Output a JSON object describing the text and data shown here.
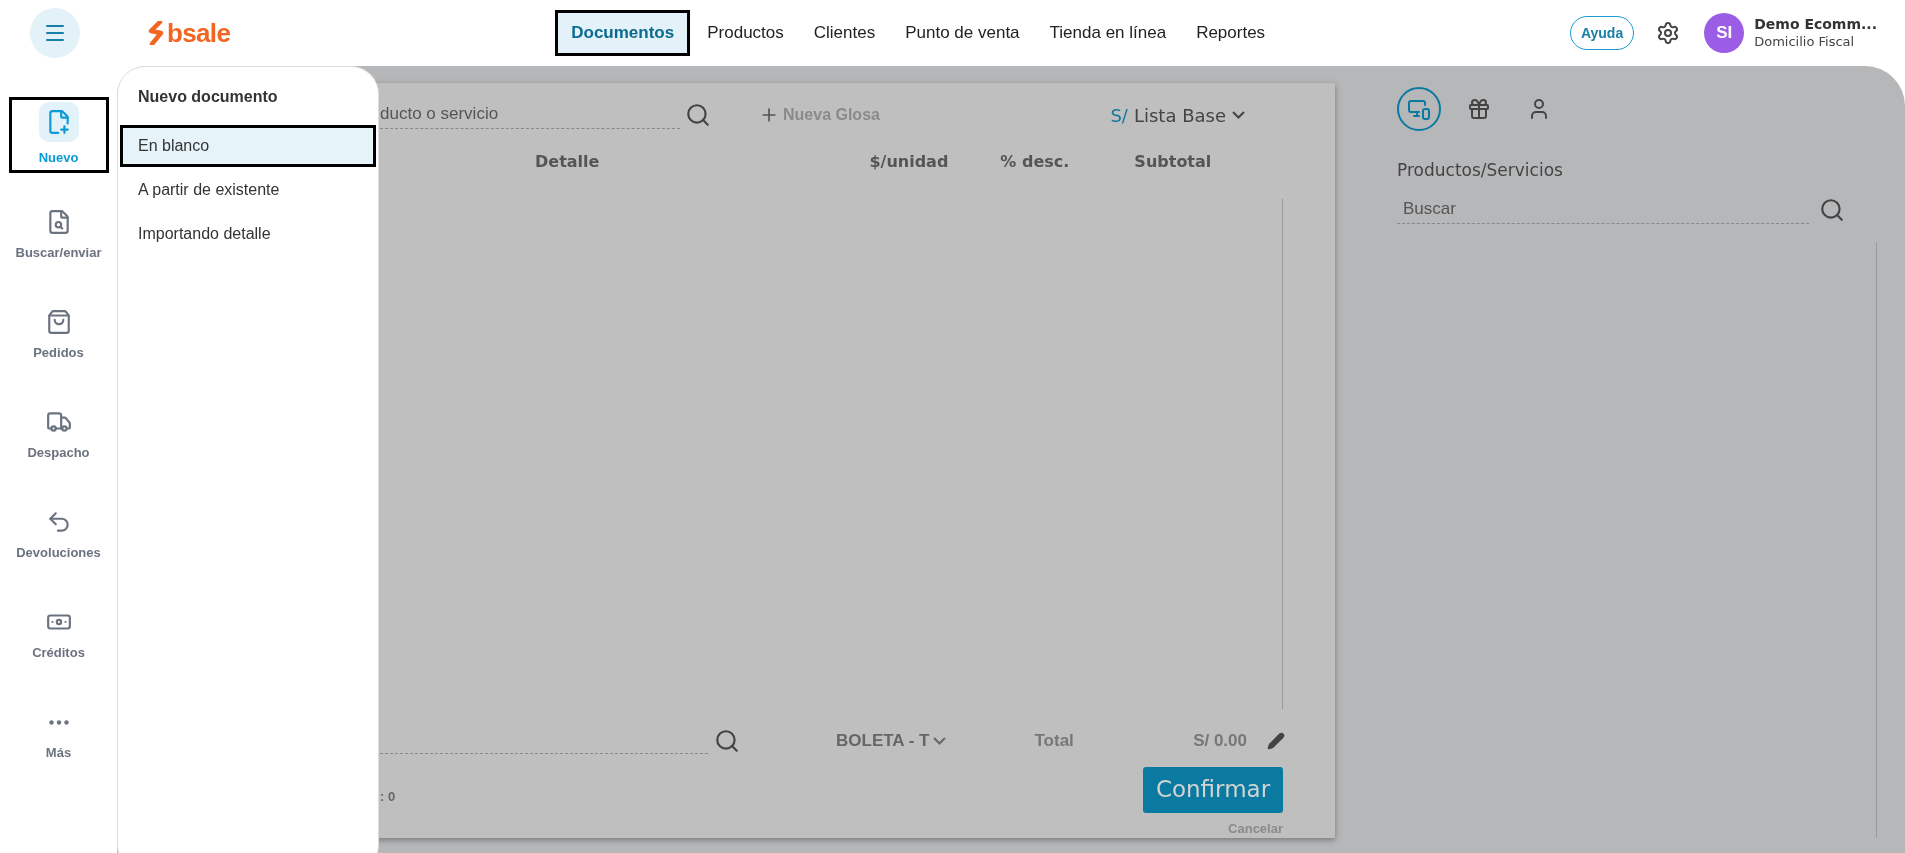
{
  "header": {
    "logo": "bsale",
    "nav": [
      {
        "label": "Documentos",
        "selected": true
      },
      {
        "label": "Productos",
        "selected": false
      },
      {
        "label": "Clientes",
        "selected": false
      },
      {
        "label": "Punto de venta",
        "selected": false
      },
      {
        "label": "Tienda en línea",
        "selected": false
      },
      {
        "label": "Reportes",
        "selected": false
      }
    ],
    "help": "Ayuda",
    "user": {
      "initials": "SI",
      "name": "Demo Ecomm...",
      "subtitle": "Domicilio Fiscal"
    }
  },
  "sidebar": {
    "items": [
      {
        "label": "Nuevo",
        "selected": true
      },
      {
        "label": "Buscar/enviar",
        "selected": false
      },
      {
        "label": "Pedidos",
        "selected": false
      },
      {
        "label": "Despacho",
        "selected": false
      },
      {
        "label": "Devoluciones",
        "selected": false
      },
      {
        "label": "Créditos",
        "selected": false
      },
      {
        "label": "Más",
        "selected": false
      }
    ]
  },
  "dropdown": {
    "title": "Nuevo documento",
    "items": [
      {
        "label": "En blanco",
        "selected": true
      },
      {
        "label": "A partir de existente",
        "selected": false
      },
      {
        "label": "Importando detalle",
        "selected": false
      }
    ]
  },
  "document": {
    "search_placeholder": "ducto o servicio",
    "add_line": "Nueva Glosa",
    "currency": "S/",
    "price_list": "Lista Base",
    "columns": [
      "Detalle",
      "$/unidad",
      "% desc.",
      "Subtotal"
    ],
    "doc_type": "BOLETA - T",
    "total_label": "Total",
    "total": "S/ 0.00",
    "count": ": 0",
    "confirm": "Confirmar",
    "cancel": "Cancelar"
  },
  "right_panel": {
    "tabs": [
      {
        "selected": true
      },
      {
        "selected": false
      },
      {
        "selected": false
      }
    ],
    "title": "Productos/Servicios",
    "search_placeholder": "Buscar"
  }
}
